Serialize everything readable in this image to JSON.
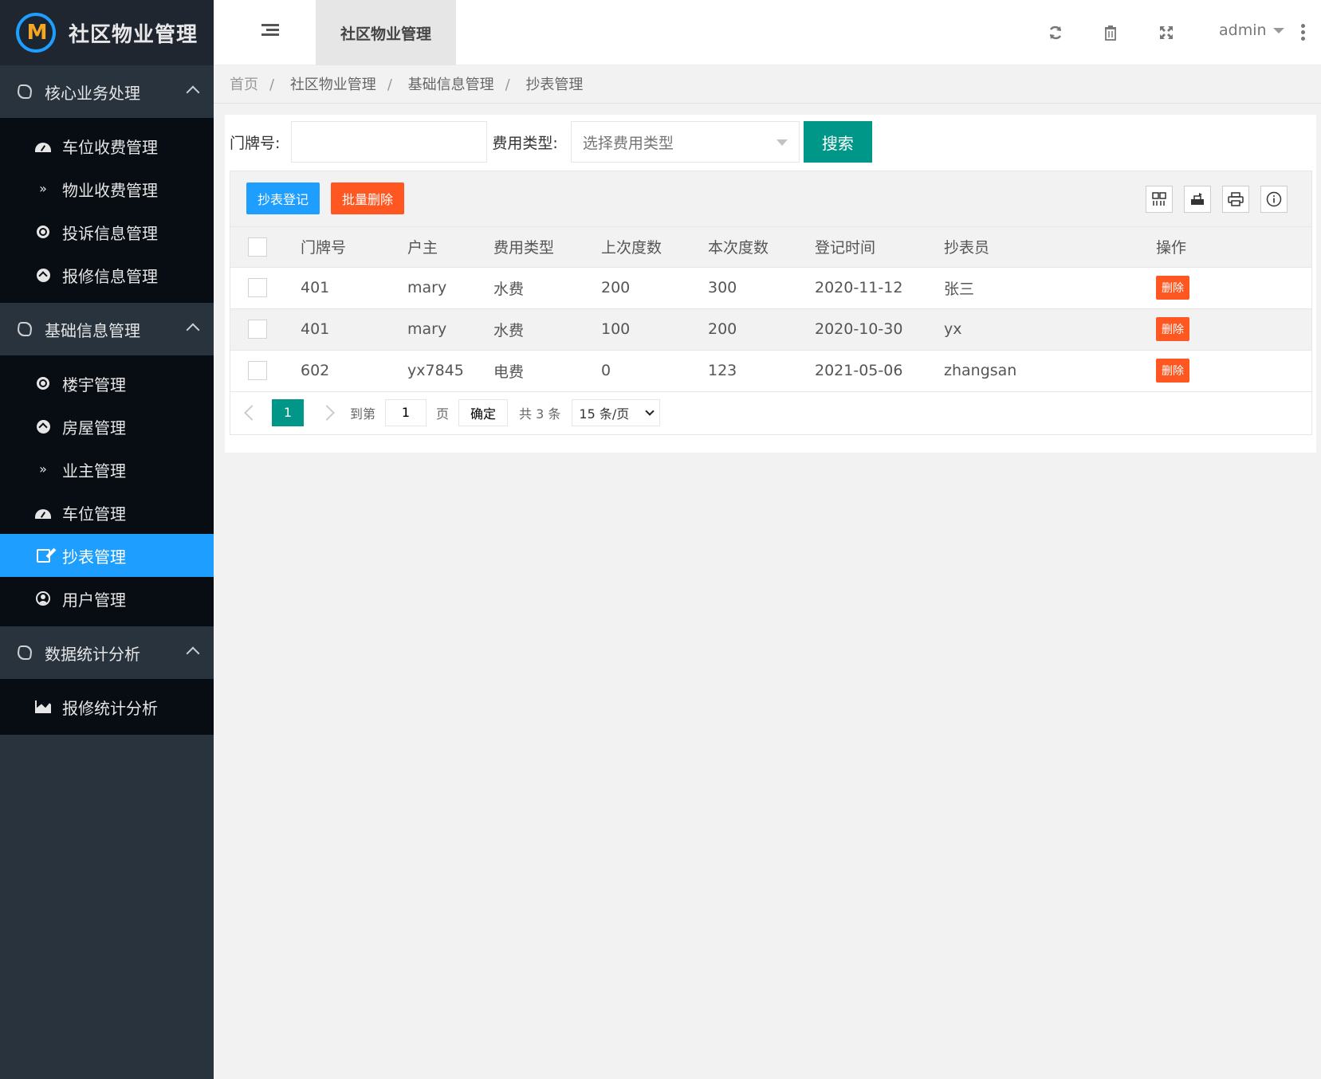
{
  "app": {
    "title": "社区物业管理",
    "tab": "社区物业管理",
    "user": "admin"
  },
  "colors": {
    "primary": "#009688",
    "blue": "#1e9fff",
    "danger": "#ff5722",
    "sidebar": "#28333e"
  },
  "sidebar": {
    "groups": [
      {
        "label": "核心业务处理",
        "items": [
          {
            "label": "车位收费管理",
            "icon": "dashboard-icon"
          },
          {
            "label": "物业收费管理",
            "icon": "double-chevron-icon"
          },
          {
            "label": "投诉信息管理",
            "icon": "dot-circle-icon"
          },
          {
            "label": "报修信息管理",
            "icon": "arrow-circle-icon"
          }
        ]
      },
      {
        "label": "基础信息管理",
        "items": [
          {
            "label": "楼宇管理",
            "icon": "dot-circle-icon"
          },
          {
            "label": "房屋管理",
            "icon": "arrow-circle-icon"
          },
          {
            "label": "业主管理",
            "icon": "double-chevron-icon"
          },
          {
            "label": "车位管理",
            "icon": "dashboard-icon"
          },
          {
            "label": "抄表管理",
            "icon": "edit-icon",
            "active": true
          },
          {
            "label": "用户管理",
            "icon": "user-circle-icon"
          }
        ]
      },
      {
        "label": "数据统计分析",
        "items": [
          {
            "label": "报修统计分析",
            "icon": "area-chart-icon"
          }
        ]
      }
    ]
  },
  "breadcrumb": [
    "首页",
    "社区物业管理",
    "基础信息管理",
    "抄表管理"
  ],
  "search": {
    "door_label": "门牌号:",
    "door_value": "",
    "fee_label": "费用类型:",
    "fee_placeholder": "选择费用类型",
    "button": "搜索"
  },
  "toolbar": {
    "add": "抄表登记",
    "batch_delete": "批量删除"
  },
  "table": {
    "columns": [
      "门牌号",
      "户主",
      "费用类型",
      "上次度数",
      "本次度数",
      "登记时间",
      "抄表员",
      "操作"
    ],
    "rows": [
      {
        "door": "401",
        "owner": "mary",
        "type": "水费",
        "prev": "200",
        "curr": "300",
        "date": "2020-11-12",
        "reader": "张三",
        "action": "删除"
      },
      {
        "door": "401",
        "owner": "mary",
        "type": "水费",
        "prev": "100",
        "curr": "200",
        "date": "2020-10-30",
        "reader": "yx",
        "action": "删除"
      },
      {
        "door": "602",
        "owner": "yx7845",
        "type": "电费",
        "prev": "0",
        "curr": "123",
        "date": "2021-05-06",
        "reader": "zhangsan",
        "action": "删除"
      }
    ]
  },
  "pager": {
    "current": "1",
    "goto_label": "到第",
    "goto_value": "1",
    "page_label": "页",
    "confirm": "确定",
    "total": "共 3 条",
    "page_size": "15 条/页"
  }
}
